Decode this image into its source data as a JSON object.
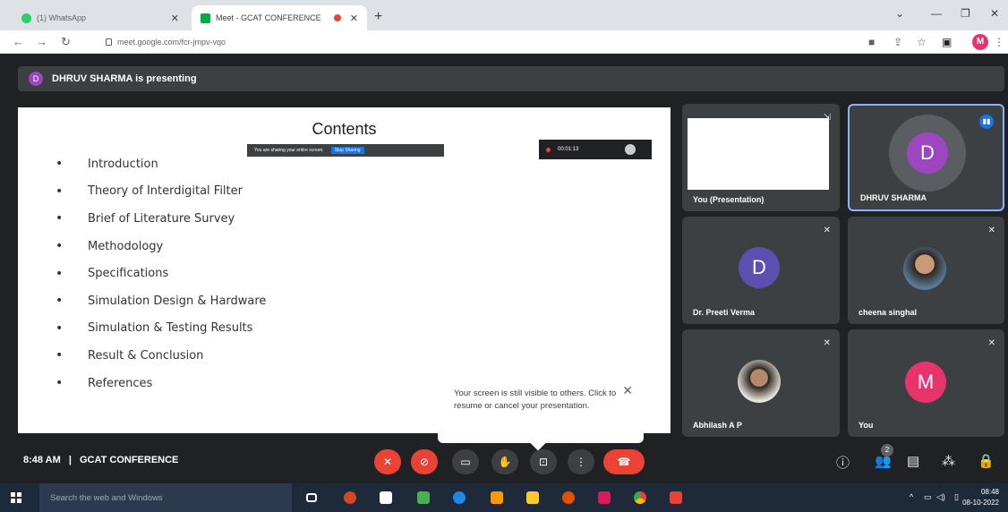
{
  "browser": {
    "tabs": [
      {
        "title": "(1) WhatsApp",
        "color": "#25d366"
      },
      {
        "title": "Meet - GCAT CONFERENCE",
        "color": "#00ac47"
      }
    ],
    "new_tab": "+",
    "url": "meet.google.com/fcr-jmpv-vqo",
    "profile_initial": "M"
  },
  "meet": {
    "presenting_banner": "DHRUV SHARMA is presenting",
    "presenter_initial": "D",
    "slide": {
      "title": "Contents",
      "items": [
        "Introduction",
        "Theory of Interdigital Filter",
        "Brief of Literature Survey",
        "Methodology",
        "Specifications",
        "Simulation Design & Hardware",
        "Simulation & Testing Results",
        "Result & Conclusion",
        "References"
      ],
      "share_notice": "You are sharing your entire screen.",
      "stop_sharing": "Stop Sharing",
      "timer": "00:01:13"
    },
    "participants": {
      "self_presentation": "You (Presentation)",
      "dhruv": {
        "name": "DHRUV SHARMA",
        "initial": "D",
        "color": "#9c46c0"
      },
      "preeti": {
        "name": "Dr. Preeti Verma",
        "initial": "D",
        "color": "#5c4fb0"
      },
      "cheena": {
        "name": "cheena singhal"
      },
      "abhilash": {
        "name": "Abhilash A P"
      },
      "you": {
        "name": "You",
        "initial": "M",
        "color": "#e8336d"
      }
    },
    "popup_text": "Your screen is still visible to others. Click to resume or cancel your presentation.",
    "meeting_time": "8:48 AM",
    "meeting_name": "GCAT CONFERENCE",
    "separator": "|",
    "people_count": "2"
  },
  "taskbar": {
    "search_placeholder": "Search the web and Windows",
    "time": "08:48",
    "date": "08-10-2022"
  }
}
